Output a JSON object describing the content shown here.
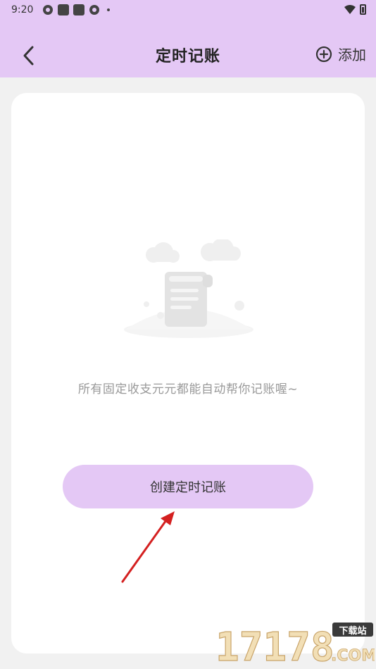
{
  "status_bar": {
    "time": "9:20"
  },
  "header": {
    "title": "定时记账",
    "add_label": "添加"
  },
  "empty_state": {
    "message": "所有固定收支元元都能自动帮你记账喔~",
    "create_button_label": "创建定时记账"
  },
  "watermark": {
    "number": "17178",
    "tag": "下载站",
    "domain": ".COM"
  },
  "colors": {
    "header_bg": "#e4c8f5",
    "button_bg": "#e4c8f5",
    "page_bg": "#f1f1f1",
    "card_bg": "#ffffff",
    "annotation_arrow": "#d42020"
  }
}
